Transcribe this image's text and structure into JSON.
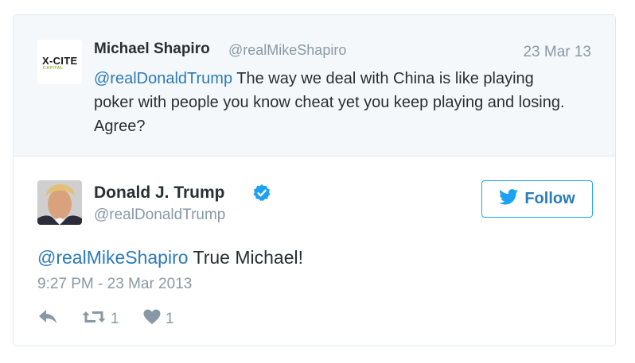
{
  "quoted_tweet": {
    "avatar_text_top": "X-CITE",
    "avatar_text_bottom": "CAPITAL",
    "name": "Michael Shapiro",
    "handle": "@realMikeShapiro",
    "date": "23 Mar 13",
    "mention": "@realDonaldTrump",
    "text": " The way we deal with China is like playing poker with people you know cheat yet you keep playing and losing. Agree?"
  },
  "main_tweet": {
    "name": "Donald J. Trump",
    "handle": "@realDonaldTrump",
    "verified": true,
    "follow_label": "Follow",
    "mention": "@realMikeShapiro",
    "text": " True Michael!",
    "timestamp": "9:27 PM - 23 Mar 2013",
    "actions": {
      "reply_icon": "reply-icon",
      "retweet_icon": "retweet-icon",
      "retweet_count": "1",
      "like_icon": "heart-icon",
      "like_count": "1"
    }
  },
  "colors": {
    "link": "#2b7bb9",
    "muted": "#8899a6",
    "text": "#292f33",
    "quoted_bg": "#f5f8fa",
    "border": "#e1e8ed",
    "twitter_blue": "#1da1f2"
  }
}
